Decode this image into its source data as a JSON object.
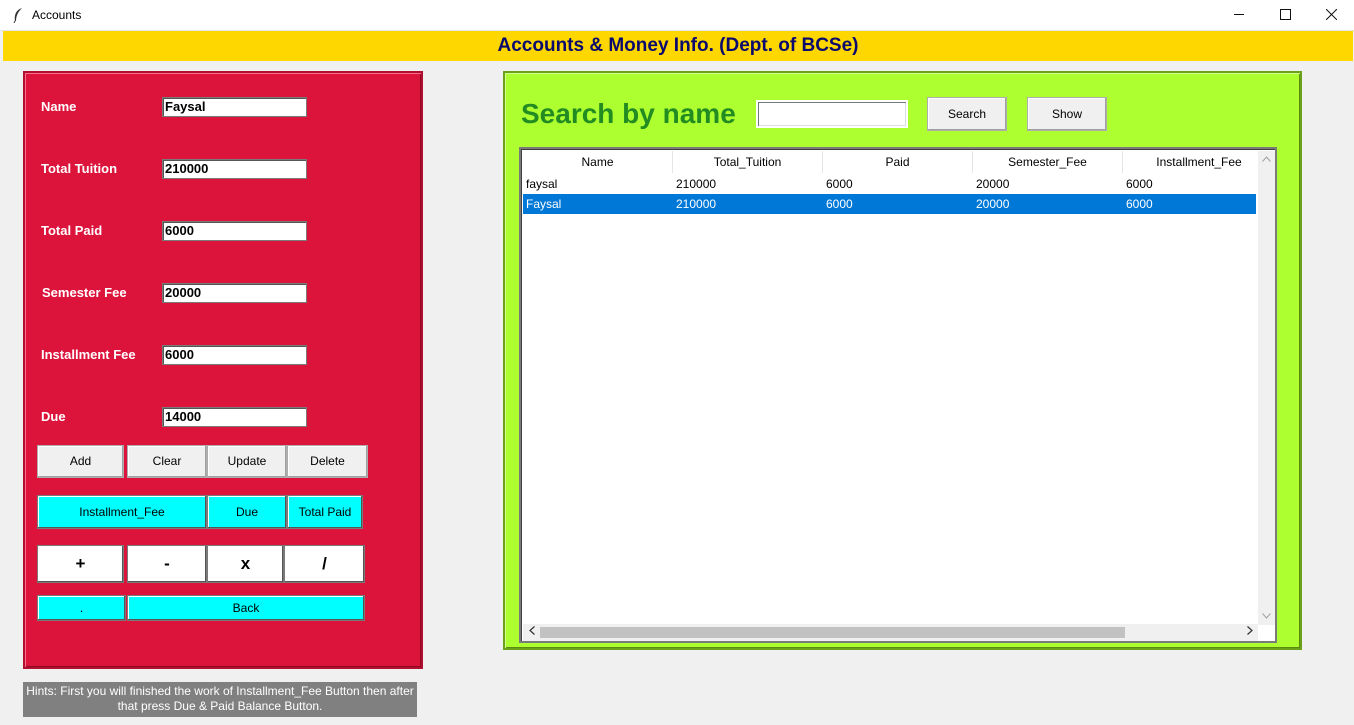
{
  "window": {
    "title": "Accounts",
    "app_icon": "feather-icon",
    "controls": {
      "minimize": "minimize-icon",
      "maximize": "maximize-icon",
      "close": "close-icon"
    }
  },
  "header": {
    "title": "Accounts & Money Info. (Dept. of BCSe)",
    "background": "#ffd700",
    "color": "#0a0a6e"
  },
  "form": {
    "background": "#dc143c",
    "fields": {
      "name": {
        "label": "Name",
        "value": "Faysal"
      },
      "total_tuition": {
        "label": "Total Tuition",
        "value": "210000"
      },
      "total_paid": {
        "label": "Total Paid",
        "value": "6000"
      },
      "semester_fee": {
        "label": "Semester Fee",
        "value": "20000"
      },
      "installment_fee": {
        "label": "Installment Fee",
        "value": "6000"
      },
      "due": {
        "label": "Due",
        "value": "14000"
      }
    },
    "buttons": {
      "add": "Add",
      "clear": "Clear",
      "update": "Update",
      "delete": "Delete",
      "installment_fee": "Installment_Fee",
      "due": "Due",
      "total_paid": "Total Paid",
      "plus": "+",
      "minus": "-",
      "multiply": "x",
      "divide": "/",
      "dot": ".",
      "back": "Back"
    }
  },
  "hint": {
    "line1": "Hints: First you will finished the work of Installment_Fee Button then after",
    "line2": "that press Due & Paid Balance Button."
  },
  "search": {
    "background": "#adff2f",
    "heading": "Search by name",
    "query": "",
    "search_button": "Search",
    "show_button": "Show"
  },
  "table": {
    "columns": [
      "Name",
      "Total_Tuition",
      "Paid",
      "Semester_Fee",
      "Installment_Fee"
    ],
    "rows": [
      [
        "faysal",
        "210000",
        "6000",
        "20000",
        "6000"
      ],
      [
        "Faysal",
        "210000",
        "6000",
        "20000",
        "6000"
      ]
    ],
    "selected_row": 1,
    "selection_color": "#0078d7"
  }
}
